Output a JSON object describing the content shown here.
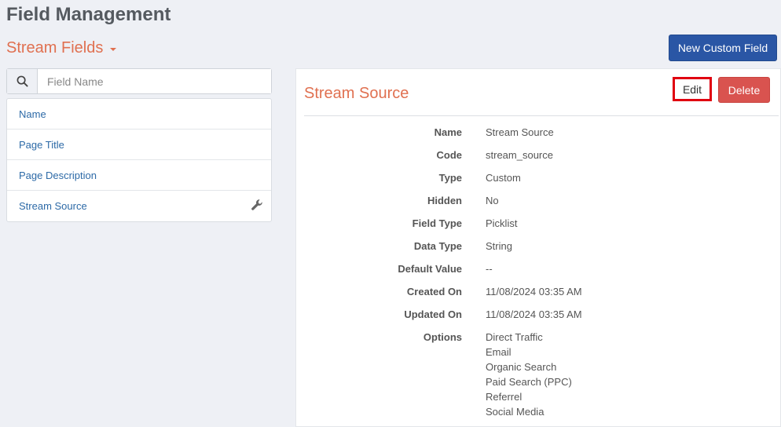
{
  "header": {
    "title": "Field Management"
  },
  "section": {
    "label": "Stream Fields"
  },
  "toolbar": {
    "new_custom_field": "New Custom Field"
  },
  "search": {
    "placeholder": "Field Name",
    "value": ""
  },
  "fields": [
    {
      "label": "Name"
    },
    {
      "label": "Page Title"
    },
    {
      "label": "Page Description"
    },
    {
      "label": "Stream Source"
    }
  ],
  "detail": {
    "title": "Stream Source",
    "edit_label": "Edit",
    "delete_label": "Delete",
    "rows": [
      {
        "label": "Name",
        "value": "Stream Source"
      },
      {
        "label": "Code",
        "value": "stream_source"
      },
      {
        "label": "Type",
        "value": "Custom"
      },
      {
        "label": "Hidden",
        "value": "No"
      },
      {
        "label": "Field Type",
        "value": "Picklist"
      },
      {
        "label": "Data Type",
        "value": "String"
      },
      {
        "label": "Default Value",
        "value": "--"
      },
      {
        "label": "Created On",
        "value": "11/08/2024 03:35 AM"
      },
      {
        "label": "Updated On",
        "value": "11/08/2024 03:35 AM"
      }
    ],
    "options_label": "Options",
    "options": [
      "Direct Traffic",
      "Email",
      "Organic Search",
      "Paid Search (PPC)",
      "Referrel",
      "Social Media"
    ]
  },
  "colors": {
    "accent": "#e07050",
    "primary": "#2a56a5",
    "danger": "#d9534f",
    "link": "#2d6aa7"
  }
}
